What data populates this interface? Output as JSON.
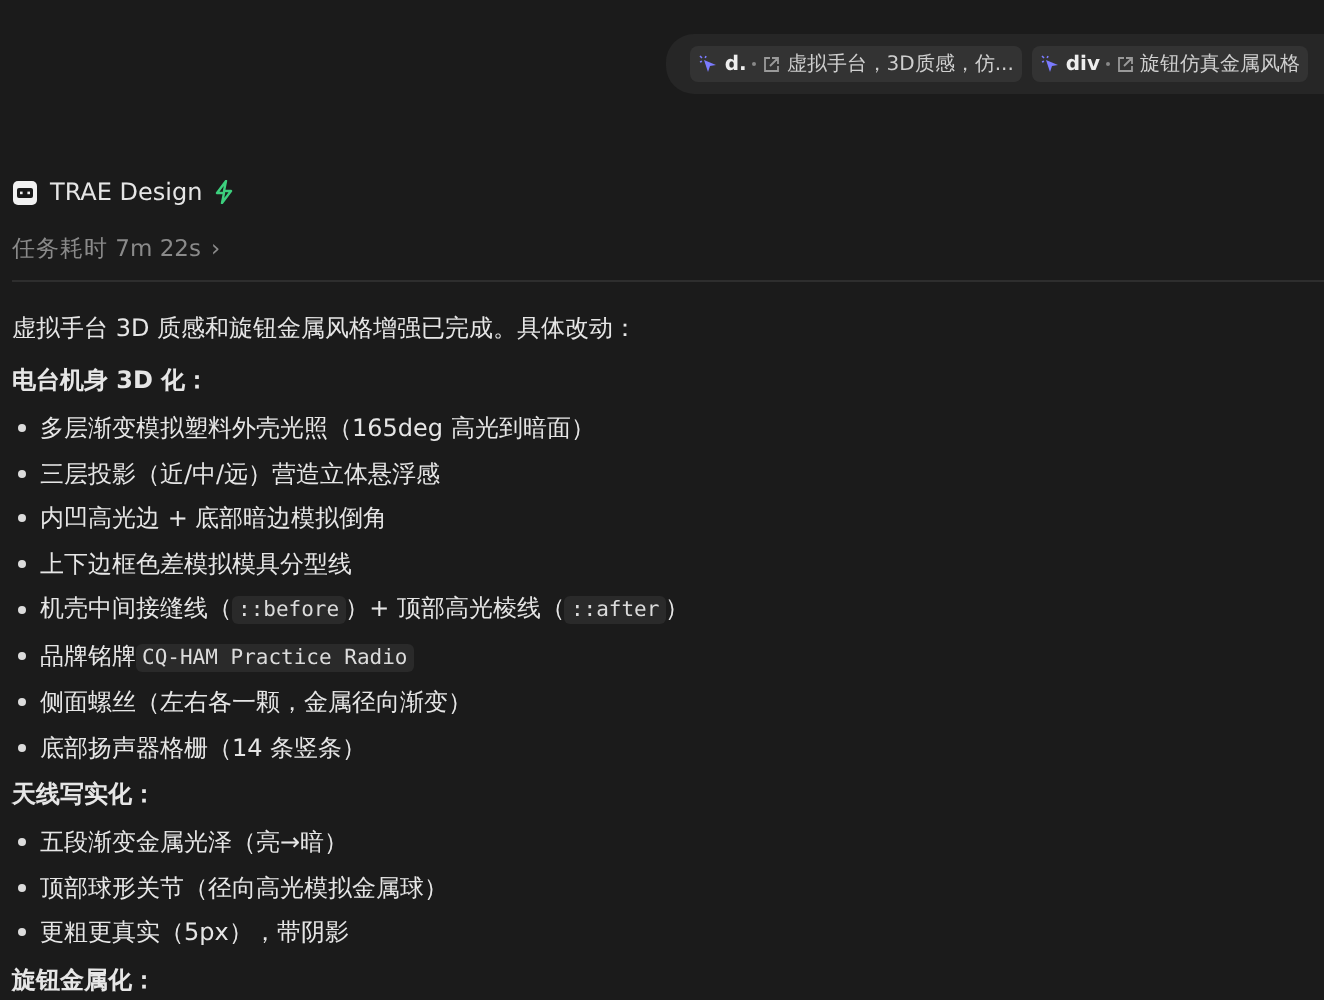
{
  "context_chips": [
    {
      "tag": "d.",
      "text": "虚拟手台，3D质感，仿..."
    },
    {
      "tag": "div",
      "text": "旋钮仿真金属风格"
    }
  ],
  "agent": {
    "name": "TRAE Design",
    "duration": "任务耗时 7m 22s",
    "duration_chevron": "›"
  },
  "content": [
    {
      "kind": "paragraph",
      "text": "虚拟手台 3D 质感和旋钮金属风格增强已完成。具体改动："
    },
    {
      "kind": "heading",
      "text": "电台机身 3D 化："
    },
    {
      "kind": "bullet",
      "segments": [
        {
          "kind": "text",
          "text": "多层渐变模拟塑料外壳光照（165deg 高光到暗面）"
        }
      ]
    },
    {
      "kind": "bullet",
      "segments": [
        {
          "kind": "text",
          "text": "三层投影（近/中/远）营造立体悬浮感"
        }
      ]
    },
    {
      "kind": "bullet",
      "segments": [
        {
          "kind": "text",
          "text": "内凹高光边 + 底部暗边模拟倒角"
        }
      ]
    },
    {
      "kind": "bullet",
      "segments": [
        {
          "kind": "text",
          "text": "上下边框色差模拟模具分型线"
        }
      ]
    },
    {
      "kind": "bullet",
      "segments": [
        {
          "kind": "text",
          "text": "机壳中间接缝线（"
        },
        {
          "kind": "code",
          "text": "::before"
        },
        {
          "kind": "text",
          "text": "）+ 顶部高光棱线（"
        },
        {
          "kind": "code",
          "text": "::after"
        },
        {
          "kind": "text",
          "text": "）"
        }
      ]
    },
    {
      "kind": "bullet",
      "segments": [
        {
          "kind": "text",
          "text": "品牌铭牌"
        },
        {
          "kind": "code",
          "text": "CQ-HAM Practice Radio"
        }
      ]
    },
    {
      "kind": "bullet",
      "segments": [
        {
          "kind": "text",
          "text": "侧面螺丝（左右各一颗，金属径向渐变）"
        }
      ]
    },
    {
      "kind": "bullet",
      "segments": [
        {
          "kind": "text",
          "text": "底部扬声器格栅（14 条竖条）"
        }
      ]
    },
    {
      "kind": "heading",
      "text": "天线写实化："
    },
    {
      "kind": "bullet",
      "segments": [
        {
          "kind": "text",
          "text": "五段渐变金属光泽（亮→暗）"
        }
      ]
    },
    {
      "kind": "bullet",
      "segments": [
        {
          "kind": "text",
          "text": "顶部球形关节（径向高光模拟金属球）"
        }
      ]
    },
    {
      "kind": "bullet",
      "segments": [
        {
          "kind": "text",
          "text": "更粗更真实（5px），带阴影"
        }
      ]
    },
    {
      "kind": "heading",
      "text": "旋钮金属化："
    }
  ]
}
